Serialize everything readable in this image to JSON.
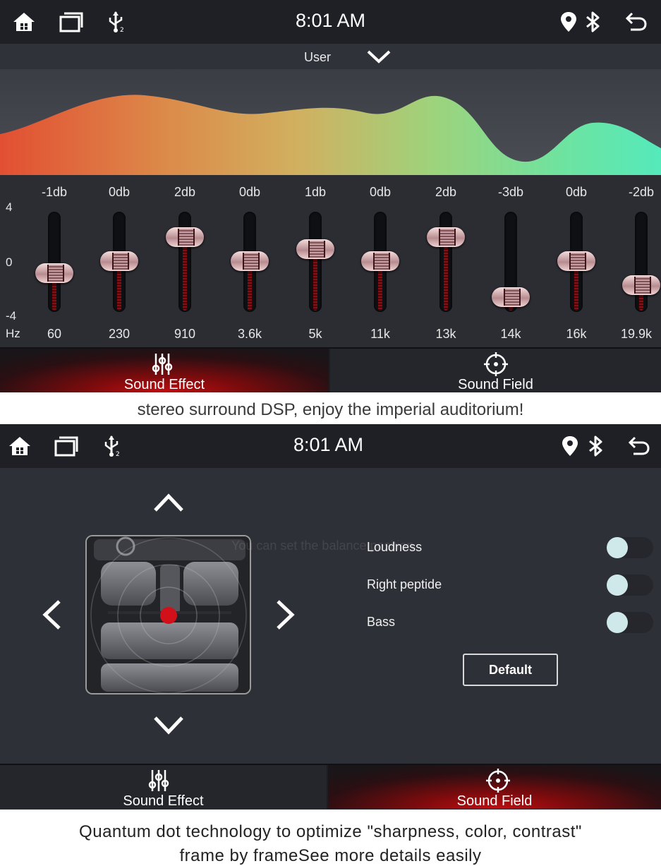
{
  "screen1": {
    "status": {
      "time": "8:01 AM"
    },
    "preset": {
      "label": "User"
    },
    "eq": {
      "axis": {
        "top": "4",
        "mid": "0",
        "bottom": "-4",
        "unit": "Hz"
      },
      "bands": [
        {
          "db": "-1db",
          "hz": "60",
          "value": -1
        },
        {
          "db": "0db",
          "hz": "230",
          "value": 0
        },
        {
          "db": "2db",
          "hz": "910",
          "value": 2
        },
        {
          "db": "0db",
          "hz": "3.6k",
          "value": 0
        },
        {
          "db": "1db",
          "hz": "5k",
          "value": 1
        },
        {
          "db": "0db",
          "hz": "11k",
          "value": 0
        },
        {
          "db": "2db",
          "hz": "13k",
          "value": 2
        },
        {
          "db": "-3db",
          "hz": "14k",
          "value": -3
        },
        {
          "db": "0db",
          "hz": "16k",
          "value": 0
        },
        {
          "db": "-2db",
          "hz": "19.9k",
          "value": -2
        }
      ]
    },
    "tabs": {
      "effect": "Sound Effect",
      "field": "Sound Field",
      "active": "effect"
    }
  },
  "caption1": "stereo surround DSP, enjoy the imperial auditorium!",
  "screen2": {
    "status": {
      "time": "8:01 AM"
    },
    "ghost_text": "You can set the balance position",
    "options": [
      {
        "label": "Loudness",
        "on": false
      },
      {
        "label": "Right peptide",
        "on": false
      },
      {
        "label": "Bass",
        "on": false
      }
    ],
    "default_label": "Default",
    "tabs": {
      "effect": "Sound Effect",
      "field": "Sound Field",
      "active": "field"
    }
  },
  "caption2": {
    "line1": "Quantum dot technology to optimize \"sharpness, color, contrast\"",
    "line2": "frame by frameSee more details easily"
  },
  "colors": {
    "accent_red": "#c10d10",
    "toggle_knob": "#cfe9ea",
    "curve_left": "#e25a36",
    "curve_right": "#5ce8b8"
  }
}
